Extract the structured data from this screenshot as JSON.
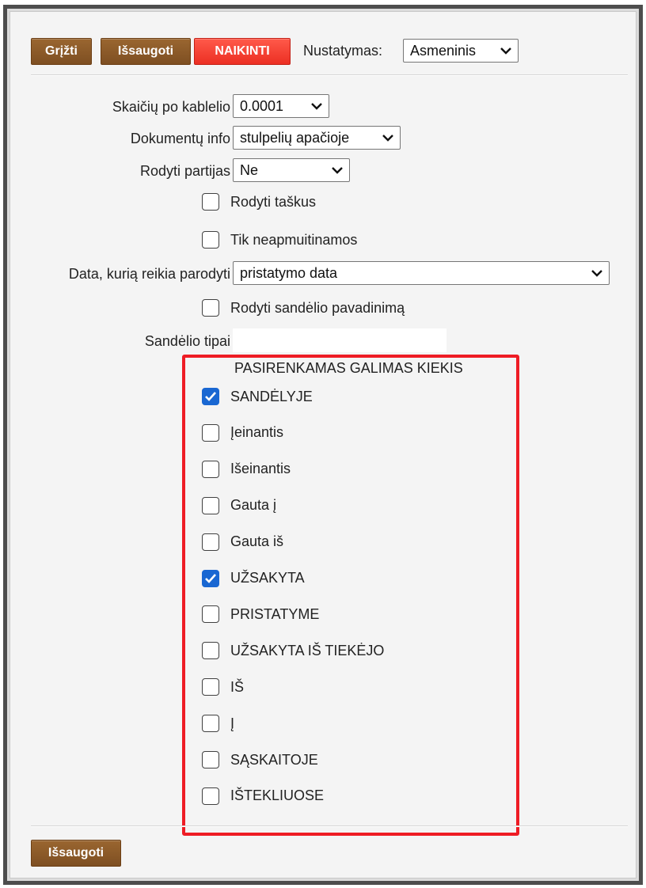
{
  "toolbar": {
    "back_label": "Grįžti",
    "save_label": "Išsaugoti",
    "delete_label": "NAIKINTI",
    "settings_label": "Nustatymas:",
    "settings_value": "Asmeninis"
  },
  "fields": {
    "decimals_label": "Skaičių po kablelio",
    "decimals_value": "0.0001",
    "docinfo_label": "Dokumentų info",
    "docinfo_value": "stulpelių apačioje",
    "batches_label": "Rodyti partijas",
    "batches_value": "Ne",
    "show_dots_label": "Rodyti taškus",
    "show_dots_checked": false,
    "customs_label": "Tik neapmuitinamos",
    "customs_checked": false,
    "date_label": "Data, kurią reikia parodyti",
    "date_value": "pristatymo data",
    "warehouse_name_label": "Rodyti sandėlio pavadinimą",
    "warehouse_name_checked": false,
    "warehouse_types_label": "Sandėlio tipai",
    "warehouse_types_value": ""
  },
  "quantity": {
    "heading": "PASIRENKAMAS GALIMAS KIEKIS",
    "items": [
      {
        "label": "SANDĖLYJE",
        "checked": true
      },
      {
        "label": "Įeinantis",
        "checked": false
      },
      {
        "label": "Išeinantis",
        "checked": false
      },
      {
        "label": "Gauta į",
        "checked": false
      },
      {
        "label": "Gauta iš",
        "checked": false
      },
      {
        "label": "UŽSAKYTA",
        "checked": true
      },
      {
        "label": "PRISTATYME",
        "checked": false
      },
      {
        "label": "UŽSAKYTA IŠ TIEKĖJO",
        "checked": false
      },
      {
        "label": "IŠ",
        "checked": false
      },
      {
        "label": "Į",
        "checked": false
      },
      {
        "label": "SĄSKAITOJE",
        "checked": false
      },
      {
        "label": "IŠTEKLIUOSE",
        "checked": false
      }
    ]
  },
  "footer": {
    "save_label": "Išsaugoti"
  },
  "colors": {
    "button_brown": "#8b5a2b",
    "button_red": "#ec2f23",
    "checkbox_blue": "#1967d2",
    "highlight_red": "#ee1c24"
  }
}
